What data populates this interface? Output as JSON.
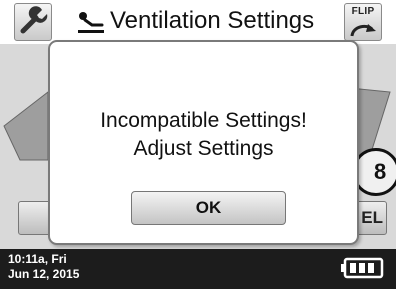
{
  "header": {
    "title": "Ventilation Settings",
    "settings_icon": "wrench-icon",
    "title_icon": "patient-icon",
    "flip_button_label": "FLIP",
    "flip_icon": "curved-arrow-icon"
  },
  "background": {
    "right_button_label": "EL",
    "circle_value": "8"
  },
  "modal": {
    "message_line1": "Incompatible Settings!",
    "message_line2": "Adjust Settings",
    "ok_label": "OK"
  },
  "footer": {
    "time": "10:11a, Fri",
    "date": "Jun 12, 2015",
    "battery_icon": "battery-full-icon",
    "battery_level": 1.0
  }
}
